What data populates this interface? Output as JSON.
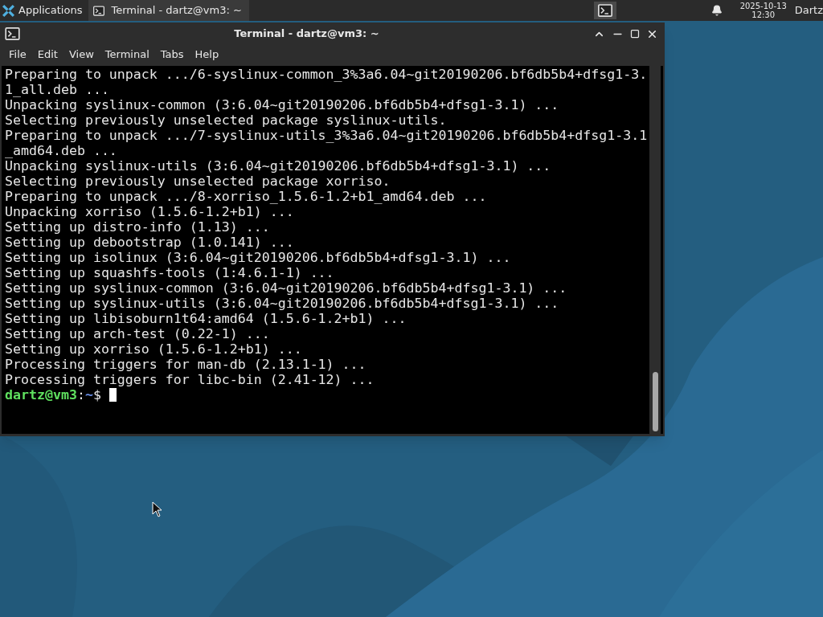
{
  "panel": {
    "applications_label": "Applications",
    "tasks": [
      {
        "label": "Terminal - dartz@vm3: ~",
        "selected": true
      }
    ],
    "date": "2025-10-13",
    "time": "12:30",
    "user": "Dartz"
  },
  "window": {
    "title": "Terminal - dartz@vm3: ~",
    "menu": [
      "File",
      "Edit",
      "View",
      "Terminal",
      "Tabs",
      "Help"
    ],
    "lines": [
      "Preparing to unpack .../6-syslinux-common_3%3a6.04~git20190206.bf6db5b4+dfsg1-3.",
      "1_all.deb ...",
      "Unpacking syslinux-common (3:6.04~git20190206.bf6db5b4+dfsg1-3.1) ...",
      "Selecting previously unselected package syslinux-utils.",
      "Preparing to unpack .../7-syslinux-utils_3%3a6.04~git20190206.bf6db5b4+dfsg1-3.1",
      "_amd64.deb ...",
      "Unpacking syslinux-utils (3:6.04~git20190206.bf6db5b4+dfsg1-3.1) ...",
      "Selecting previously unselected package xorriso.",
      "Preparing to unpack .../8-xorriso_1.5.6-1.2+b1_amd64.deb ...",
      "Unpacking xorriso (1.5.6-1.2+b1) ...",
      "Setting up distro-info (1.13) ...",
      "Setting up debootstrap (1.0.141) ...",
      "Setting up isolinux (3:6.04~git20190206.bf6db5b4+dfsg1-3.1) ...",
      "Setting up squashfs-tools (1:4.6.1-1) ...",
      "Setting up syslinux-common (3:6.04~git20190206.bf6db5b4+dfsg1-3.1) ...",
      "Setting up syslinux-utils (3:6.04~git20190206.bf6db5b4+dfsg1-3.1) ...",
      "Setting up libisoburn1t64:amd64 (1.5.6-1.2+b1) ...",
      "Setting up arch-test (0.22-1) ...",
      "Setting up xorriso (1.5.6-1.2+b1) ...",
      "Processing triggers for man-db (2.13.1-1) ...",
      "Processing triggers for libc-bin (2.41-12) ..."
    ],
    "prompt": {
      "user_host": "dartz@vm3",
      "separator": ":",
      "path": "~",
      "symbol": "$"
    }
  }
}
